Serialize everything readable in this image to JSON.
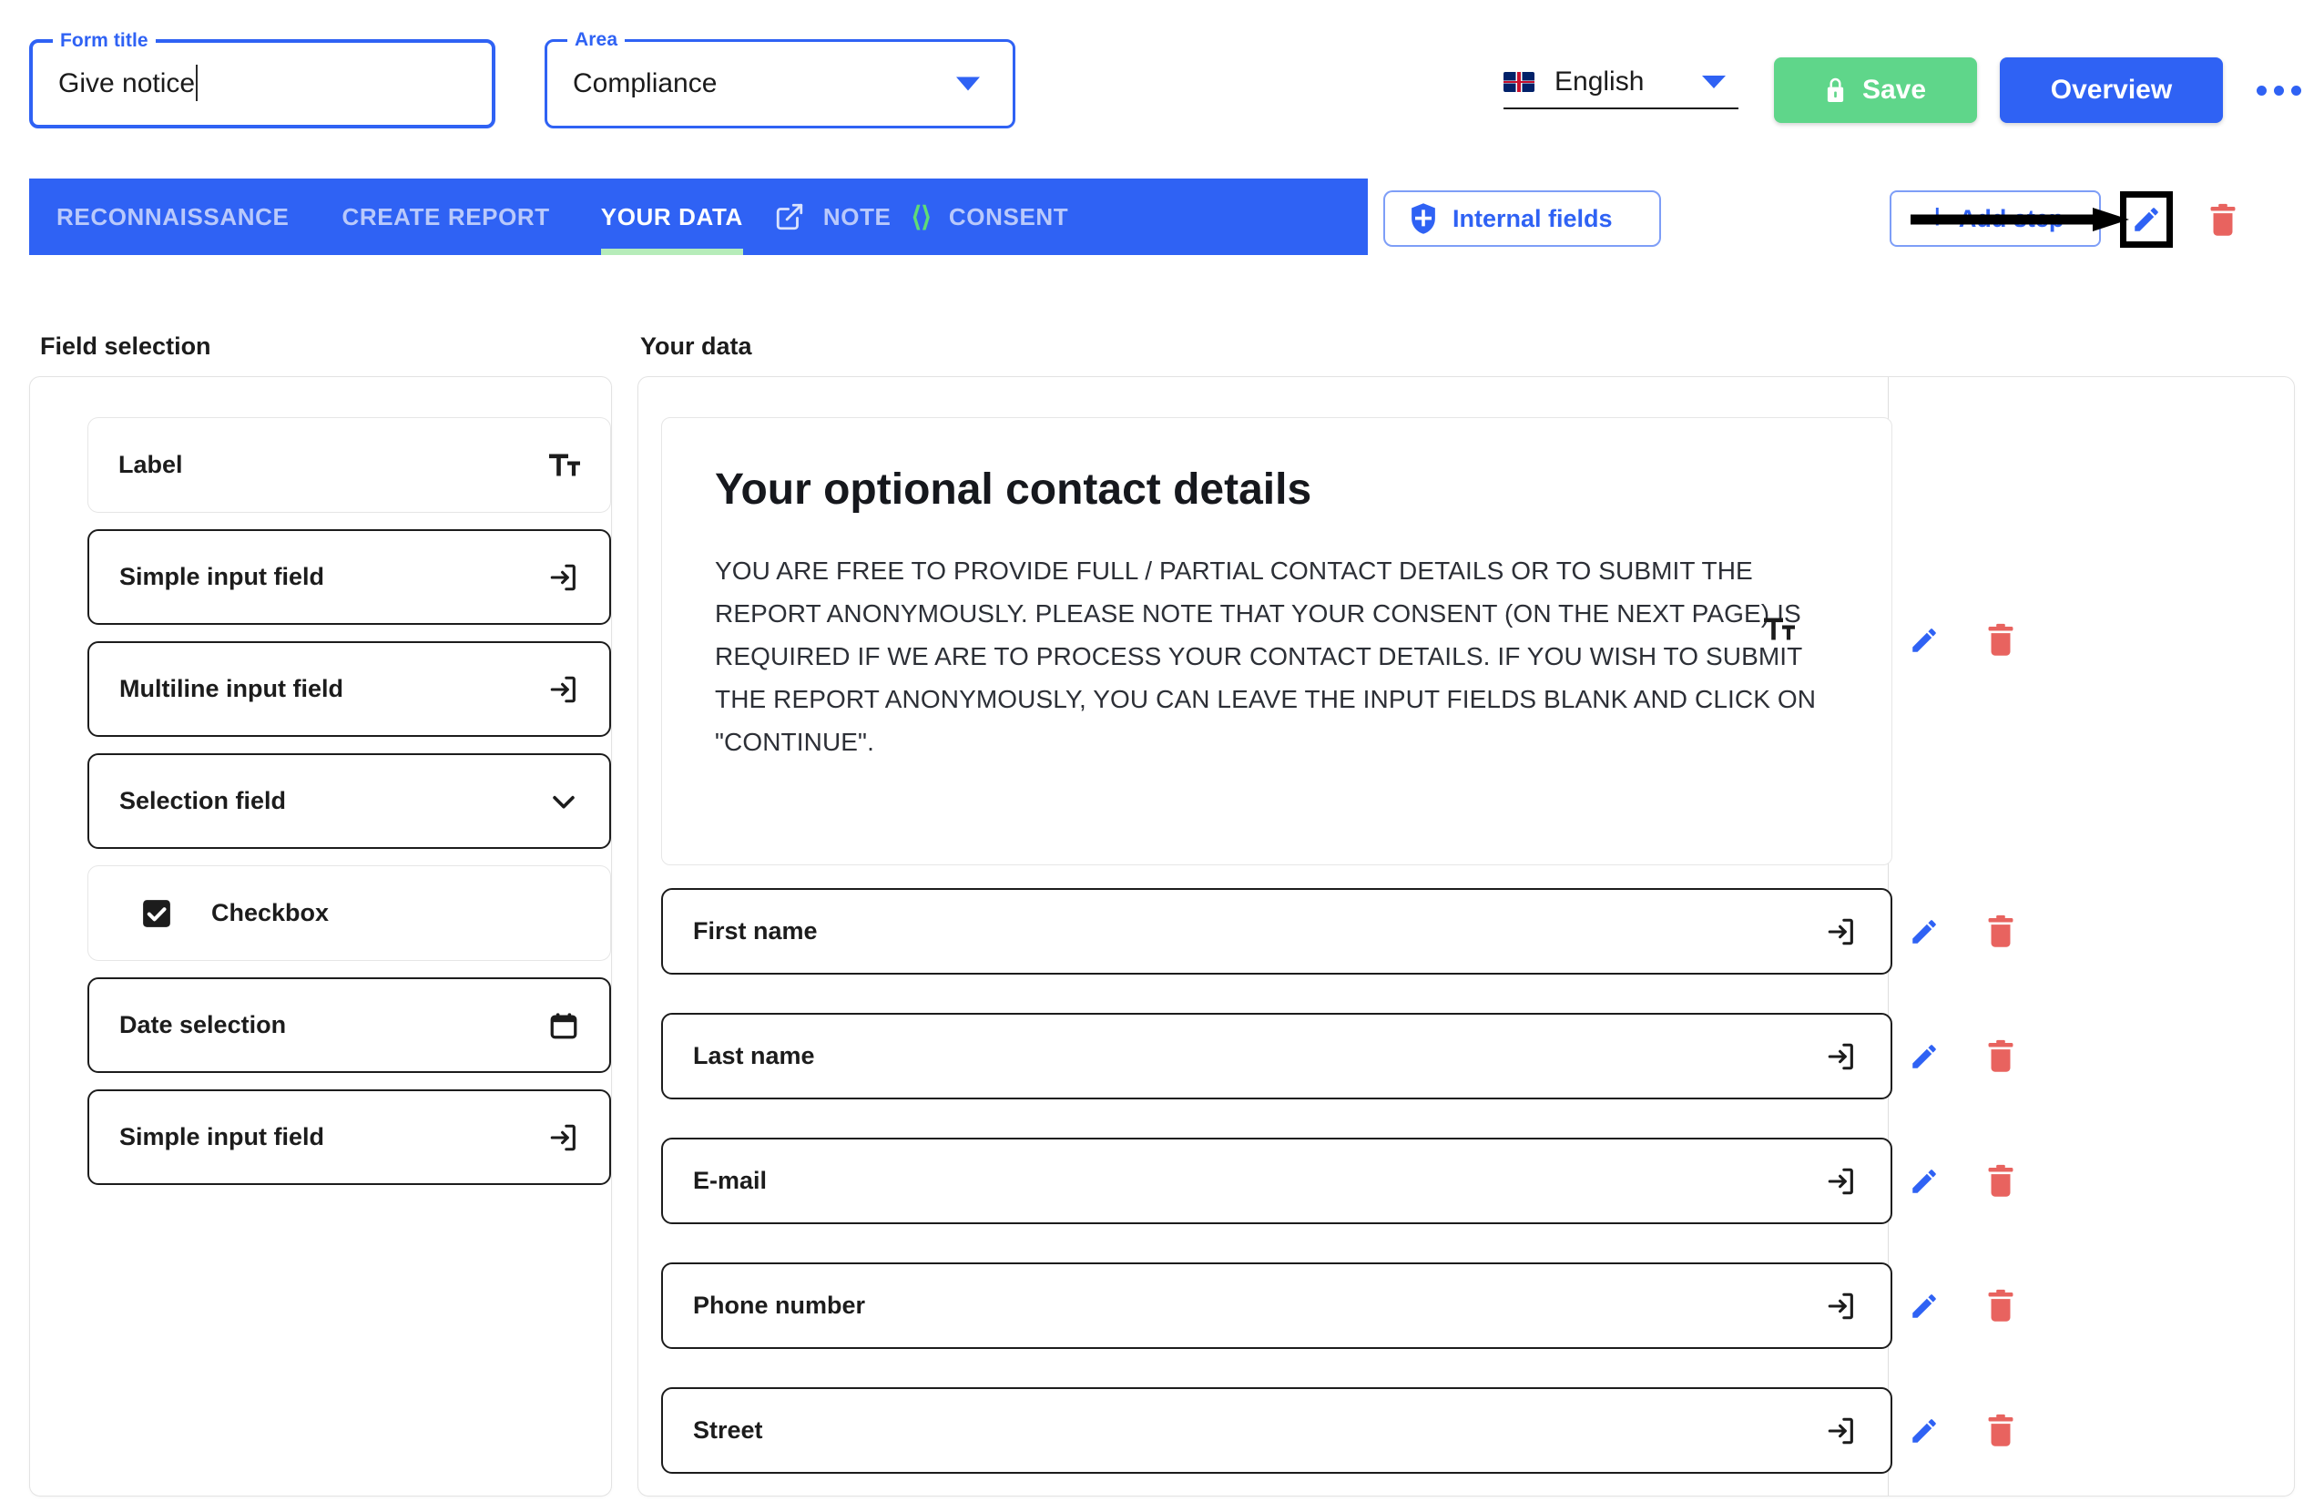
{
  "header": {
    "form_title": {
      "legend": "Form title",
      "value": "Give notice"
    },
    "area": {
      "legend": "Area",
      "value": "Compliance"
    },
    "language": {
      "value": "English",
      "flag_icon": "uk-flag-icon"
    },
    "save_label": "Save",
    "overview_label": "Overview",
    "more_icon": "more-horizontal-icon"
  },
  "tabs": [
    {
      "label": "RECONNAISSANCE",
      "active": false
    },
    {
      "label": "CREATE REPORT",
      "active": false
    },
    {
      "label": "YOUR DATA",
      "active": true
    },
    {
      "label": "NOTE",
      "active": false
    },
    {
      "label": "CONSENT",
      "active": false
    }
  ],
  "tab_icons": {
    "external_link": "external-link-icon",
    "code": "code-brackets-icon"
  },
  "toolbar": {
    "internal_fields_label": "Internal fields",
    "internal_fields_icon": "shield-icon",
    "add_step_label": "Add step",
    "add_step_plus": "+",
    "edit_step_icon": "pencil-icon",
    "delete_step_icon": "trash-icon"
  },
  "left_panel": {
    "title": "Field selection",
    "items": [
      {
        "label": "Label",
        "icon": "text-format-icon",
        "style": "soft"
      },
      {
        "label": "Simple input field",
        "icon": "input-field-icon",
        "style": "strong"
      },
      {
        "label": "Multiline input field",
        "icon": "input-field-icon",
        "style": "strong"
      },
      {
        "label": "Selection field",
        "icon": "chevron-down-icon",
        "style": "strong"
      },
      {
        "label": "Checkbox",
        "icon": "checkbox-checked-icon",
        "style": "soft"
      },
      {
        "label": "Date selection",
        "icon": "calendar-icon",
        "style": "strong"
      },
      {
        "label": "Simple input field",
        "icon": "input-field-icon",
        "style": "strong"
      }
    ]
  },
  "right_panel": {
    "title": "Your data",
    "text_block": {
      "heading": "Your optional contact details",
      "body": "YOU ARE FREE TO PROVIDE FULL / PARTIAL CONTACT DETAILS OR TO SUBMIT THE REPORT ANONYMOUSLY. PLEASE NOTE THAT YOUR CONSENT (ON THE NEXT PAGE) IS REQUIRED IF WE ARE TO PROCESS YOUR CONTACT DETAILS. IF YOU WISH TO SUBMIT THE REPORT ANONYMOUSLY, YOU CAN LEAVE THE INPUT FIELDS BLANK AND CLICK ON \"CONTINUE\".",
      "type_icon": "text-format-icon"
    },
    "fields": [
      {
        "label": "First name",
        "icon": "input-field-icon"
      },
      {
        "label": "Last name",
        "icon": "input-field-icon"
      },
      {
        "label": "E-mail",
        "icon": "input-field-icon"
      },
      {
        "label": "Phone number",
        "icon": "input-field-icon"
      },
      {
        "label": "Street",
        "icon": "input-field-icon"
      }
    ],
    "row_actions": {
      "edit_icon": "pencil-icon",
      "delete_icon": "trash-icon"
    }
  },
  "colors": {
    "primary_blue": "#2f62f4",
    "save_green": "#5fd68a",
    "active_tab_underline": "#b6ecb9",
    "code_icon_green": "#5fdc76",
    "delete_red": "#e8635f",
    "text_dark": "#1c1c1c"
  }
}
